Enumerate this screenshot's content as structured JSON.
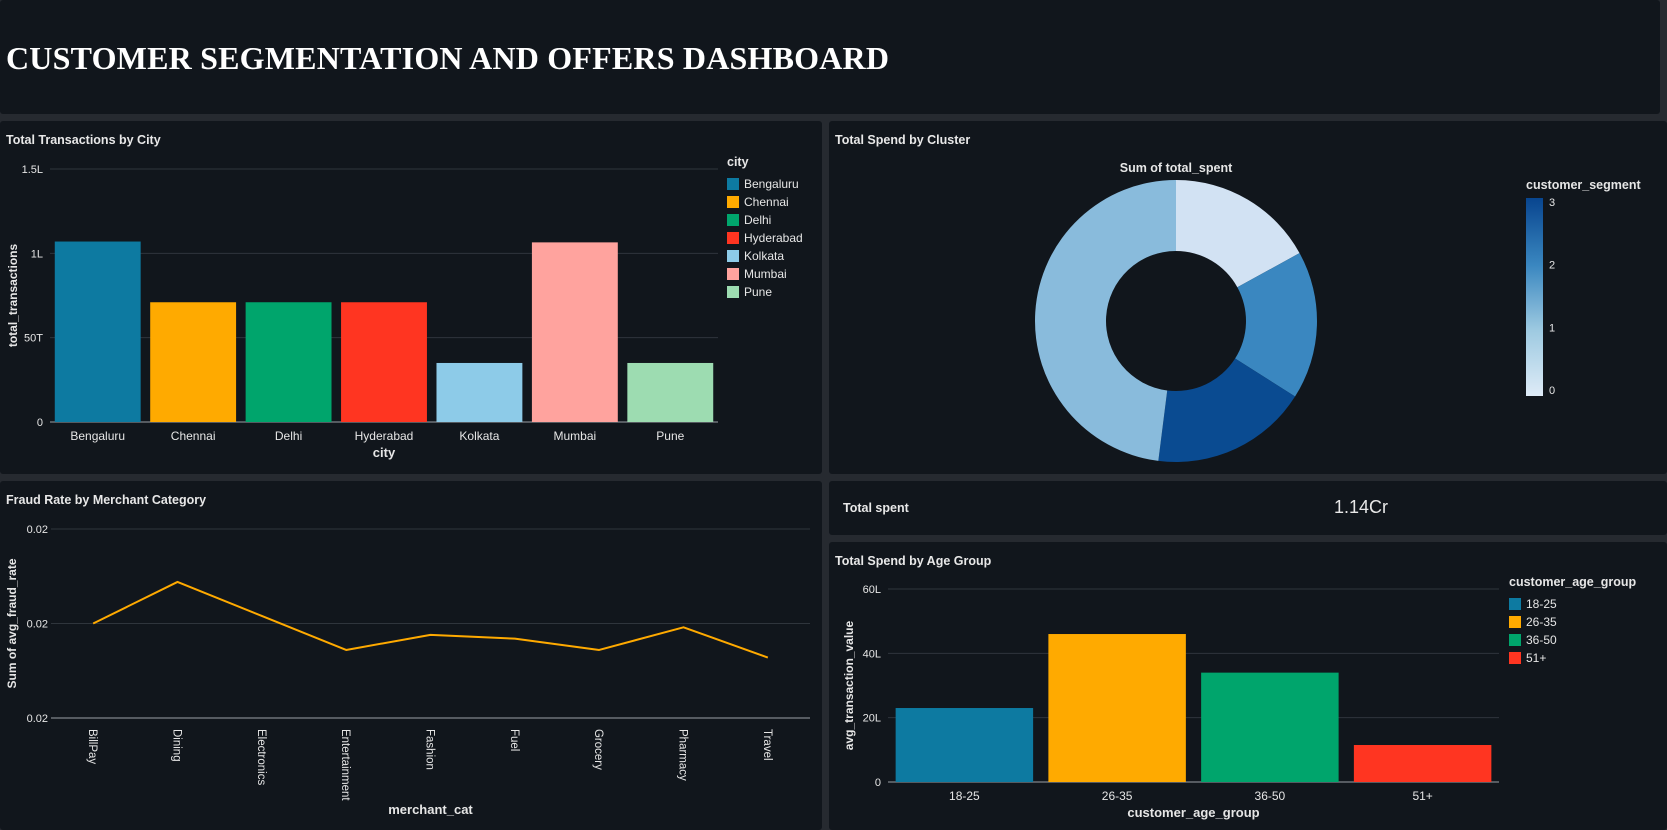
{
  "dashboard": {
    "title": "CUSTOMER SEGMENTATION AND OFFERS DASHBOARD"
  },
  "kpi": {
    "label": "Total spent",
    "value": "1.14Cr"
  },
  "chart_data": [
    {
      "id": "city",
      "type": "bar",
      "title": "Total Transactions by City",
      "xlabel": "city",
      "ylabel": "total_transactions",
      "legend_title": "city",
      "legend_position": "right",
      "categories": [
        "Bengaluru",
        "Chennai",
        "Delhi",
        "Hyderabad",
        "Kolkata",
        "Mumbai",
        "Pune"
      ],
      "values": [
        107000,
        71000,
        71000,
        71000,
        35000,
        106500,
        35000
      ],
      "colors": [
        "#0d7aa1",
        "#ffaa00",
        "#00a56c",
        "#ff3521",
        "#8dcbe8",
        "#ffa39e",
        "#9ddcb1"
      ],
      "yticks": [
        0,
        50000,
        100000,
        150000
      ],
      "ytick_labels": [
        "0",
        "50T",
        "1L",
        "1.5L"
      ],
      "ylim": [
        0,
        150000
      ],
      "grid": true
    },
    {
      "id": "cluster",
      "type": "pie",
      "title": "Total Spend by Cluster",
      "subtitle": "Sum of total_spent",
      "legend_title": "customer_segment",
      "colorbar_ticks": [
        "3",
        "2",
        "1",
        "0"
      ],
      "slices": [
        {
          "segment": 0,
          "value": 17,
          "color": "#d2e2f3"
        },
        {
          "segment": 2,
          "value": 17,
          "color": "#3a87c0"
        },
        {
          "segment": 3,
          "value": 18,
          "color": "#0a4b91"
        },
        {
          "segment": 1,
          "value": 48,
          "color": "#89bbdc"
        }
      ]
    },
    {
      "id": "fraud",
      "type": "line",
      "title": "Fraud Rate by Merchant Category",
      "xlabel": "merchant_cat",
      "ylabel": "Sum of avg_fraud_rate",
      "categories": [
        "BillPay",
        "Dining",
        "Electronics",
        "Entertainment",
        "Fashion",
        "Fuel",
        "Grocery",
        "Pharmacy",
        "Travel"
      ],
      "values": [
        0.02,
        0.0211,
        0.0202,
        0.0193,
        0.0197,
        0.0196,
        0.0193,
        0.0199,
        0.0191
      ],
      "ylim": [
        0.0175,
        0.0225
      ],
      "yticks": [
        0.0175,
        0.02,
        0.0225
      ],
      "ytick_labels": [
        "0.02",
        "0.02",
        "0.02"
      ],
      "color": "#ffaa00",
      "grid": true
    },
    {
      "id": "age",
      "type": "bar",
      "title": "Total Spend by Age Group",
      "xlabel": "customer_age_group",
      "ylabel": "avg_transaction_value",
      "legend_title": "customer_age_group",
      "legend_position": "right",
      "categories": [
        "18-25",
        "26-35",
        "36-50",
        "51+"
      ],
      "values": [
        2300000,
        4600000,
        3400000,
        1150000
      ],
      "colors": [
        "#0d7aa1",
        "#ffaa00",
        "#00a56c",
        "#ff3521"
      ],
      "yticks": [
        0,
        2000000,
        4000000,
        6000000
      ],
      "ytick_labels": [
        "0",
        "20L",
        "40L",
        "60L"
      ],
      "ylim": [
        0,
        6000000
      ],
      "grid": true
    }
  ]
}
